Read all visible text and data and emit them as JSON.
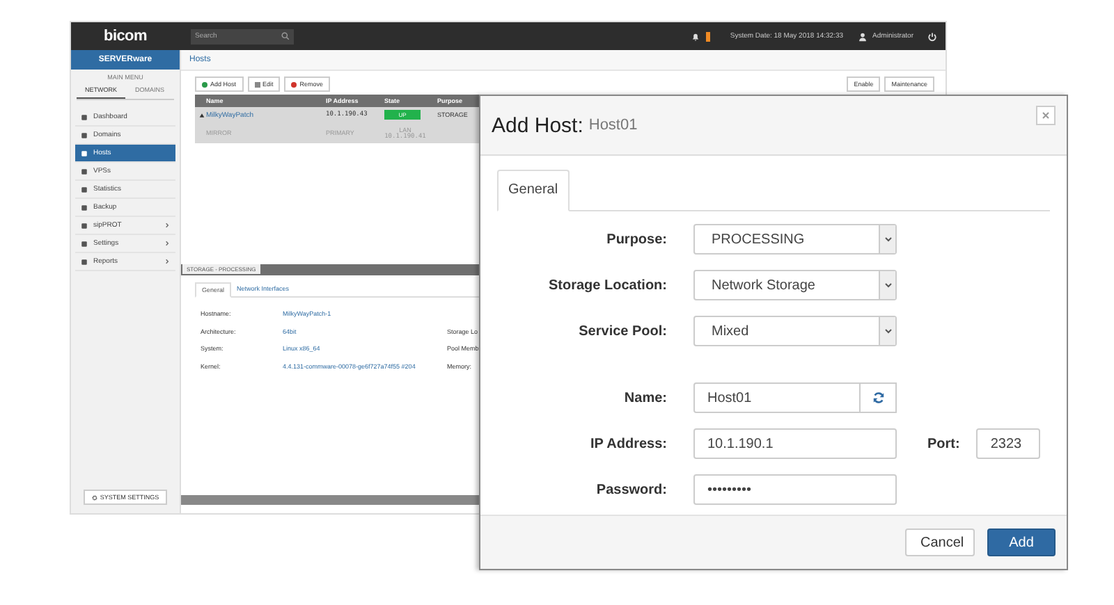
{
  "app": {
    "logo": "bicom",
    "search": {
      "placeholder": "Search"
    },
    "system_date": "System Date: 18 May 2018 14:32:33",
    "user": "Administrator"
  },
  "sidebar": {
    "product": "SERVERware",
    "heading": "MAIN MENU",
    "tabs": [
      {
        "label": "NETWORK",
        "selected": true
      },
      {
        "label": "DOMAINS",
        "selected": false
      }
    ],
    "items": [
      {
        "label": "Dashboard",
        "selected": false,
        "submenu": false
      },
      {
        "label": "Domains",
        "selected": false,
        "submenu": false
      },
      {
        "label": "Hosts",
        "selected": true,
        "submenu": false
      },
      {
        "label": "VPSs",
        "selected": false,
        "submenu": false
      },
      {
        "label": "Statistics",
        "selected": false,
        "submenu": false
      },
      {
        "label": "Backup",
        "selected": false,
        "submenu": false
      },
      {
        "label": "sipPROT",
        "selected": false,
        "submenu": true
      },
      {
        "label": "Settings",
        "selected": false,
        "submenu": true
      },
      {
        "label": "Reports",
        "selected": false,
        "submenu": true
      }
    ],
    "footer_button": "SYSTEM SETTINGS"
  },
  "main": {
    "title": "Hosts",
    "toolbar": [
      {
        "kind": "add",
        "label": "Add Host"
      },
      {
        "kind": "edit",
        "label": "Edit"
      },
      {
        "kind": "remove",
        "label": "Remove"
      }
    ],
    "toolbar_right": [
      "Enable",
      "Maintenance"
    ],
    "table": {
      "columns": [
        "Name",
        "IP Address",
        "State",
        "Purpose"
      ],
      "rows": [
        {
          "name": "MilkyWayPatch",
          "ip": "10.1.190.43",
          "state": "UP",
          "color": "#22b24c",
          "purpose": "STORAGE",
          "selected": true,
          "expanded": true,
          "children": [
            {
              "name": "MIRROR",
              "ip": "PRIMARY",
              "state": "LAN",
              "state_detail": "10.1.190.41"
            }
          ]
        }
      ]
    },
    "detail": {
      "title": "STORAGE - PROCESSING",
      "tabs": [
        {
          "label": "General",
          "selected": true
        },
        {
          "label": "Network Interfaces",
          "selected": false
        }
      ],
      "fields": [
        {
          "label": "Hostname:",
          "value": "MilkyWayPatch-1"
        },
        {
          "label": "Architecture:",
          "value": "64bit",
          "side_label": "Storage Lo"
        },
        {
          "label": "System:",
          "value": "Linux x86_64",
          "side_label": "Pool Memb"
        },
        {
          "label": "Kernel:",
          "value": "4.4.131-commware-00078-ge6f727a74f55 #204",
          "side_label": "Memory:"
        }
      ]
    }
  },
  "dialog": {
    "title": "Add Host:",
    "subtitle": "Host01",
    "tabs": [
      {
        "label": "General",
        "selected": true
      }
    ],
    "fields": [
      {
        "kind": "select",
        "label": "Purpose:",
        "value": "PROCESSING"
      },
      {
        "kind": "select",
        "label": "Storage Location:",
        "value": "Network Storage"
      },
      {
        "kind": "select",
        "label": "Service Pool:",
        "value": "Mixed"
      },
      {
        "kind": "refresh",
        "label": "Name:",
        "value": "Host01"
      },
      {
        "kind": "port",
        "label": "IP Address:",
        "value": "10.1.190.1",
        "port_label": "Port:",
        "port_value": "2323"
      },
      {
        "kind": "text",
        "label": "Password:",
        "value": "•••••••••"
      }
    ],
    "buttons": [
      {
        "kind": "secondary",
        "label": "Cancel"
      },
      {
        "kind": "primary",
        "label": "Add"
      }
    ]
  }
}
